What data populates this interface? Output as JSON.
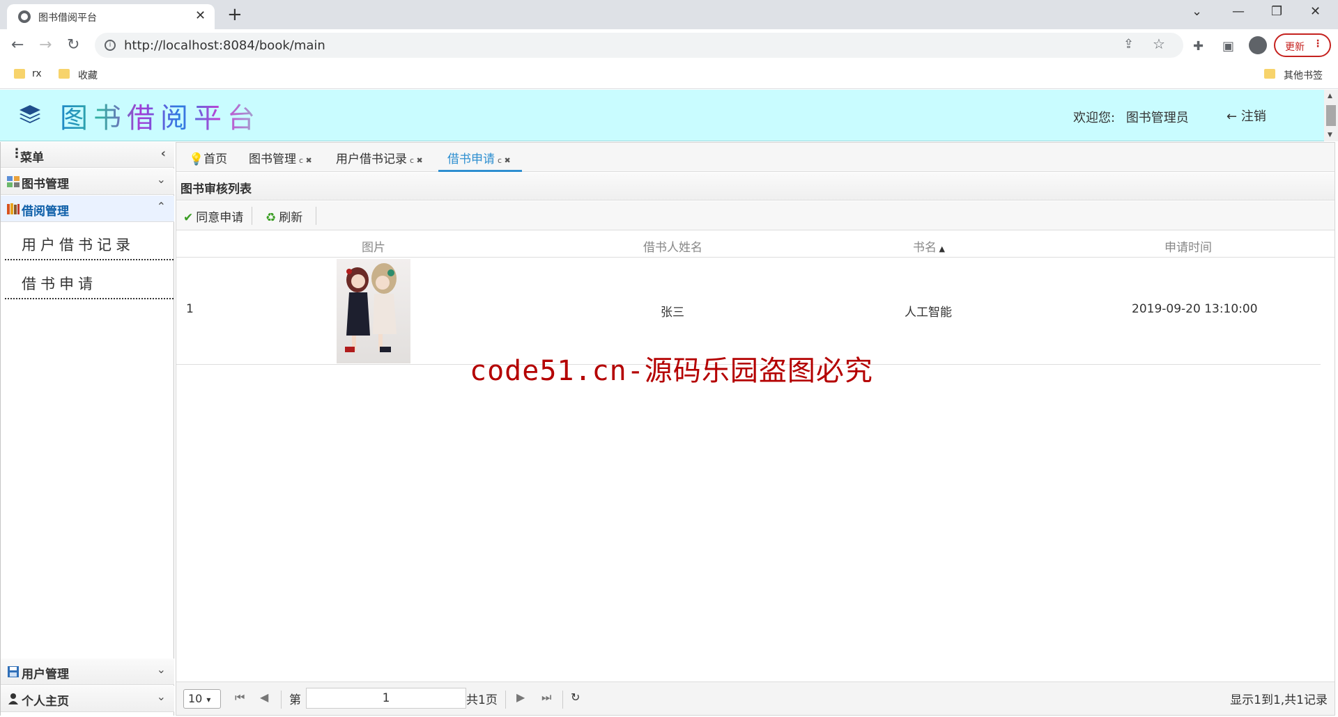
{
  "browser": {
    "tab_title": "图书借阅平台",
    "tab_close": "✕",
    "new_tab": "+",
    "url": "http://localhost:8084/book/main",
    "update_label": "更新",
    "bookmarks": [
      "rx",
      "收藏"
    ],
    "other_bookmarks": "其他书签"
  },
  "header": {
    "title": "图书借阅平台",
    "welcome_label": "欢迎您:",
    "user_name": "图书管理员",
    "logout_label": "注销"
  },
  "sidebar": {
    "menu_title": "菜单",
    "panels": [
      {
        "label": "图书管理",
        "icon": "grid-icon"
      },
      {
        "label": "借阅管理",
        "icon": "books-icon"
      },
      {
        "label": "用户管理",
        "icon": "save-icon"
      },
      {
        "label": "个人主页",
        "icon": "person-icon"
      }
    ],
    "items": [
      "用户借书记录",
      "借书申请"
    ]
  },
  "tabs": [
    {
      "label": "首页"
    },
    {
      "label": "图书管理"
    },
    {
      "label": "用户借书记录"
    },
    {
      "label": "借书申请",
      "active": true
    }
  ],
  "list": {
    "title": "图书审核列表",
    "approve_label": "同意申请",
    "refresh_label": "刷新",
    "columns": [
      "图片",
      "借书人姓名",
      "书名",
      "申请时间"
    ],
    "rows": [
      {
        "index": "1",
        "borrower": "张三",
        "book": "人工智能",
        "time": "2019-09-20 13:10:00"
      }
    ]
  },
  "watermark": "code51.cn-源码乐园盗图必究",
  "pager": {
    "page_size": "10",
    "page_prefix": "第",
    "page_value": "1",
    "page_total": "共1页",
    "info": "显示1到1,共1记录"
  },
  "colors": {
    "header_bg": "#c9fcff",
    "accent": "#2e8fd0",
    "watermark": "#b40000"
  }
}
